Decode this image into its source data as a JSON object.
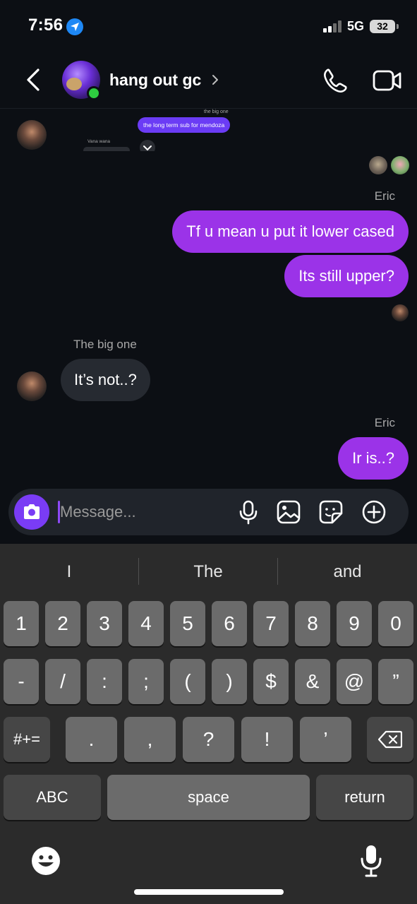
{
  "status_bar": {
    "time": "7:56",
    "network": "5G",
    "battery": "32"
  },
  "header": {
    "title": "hang out gc"
  },
  "reply_preview": {
    "sender": "the big one",
    "text": "the long term sub for mendoza",
    "second_sender": "Vana wana"
  },
  "messages": [
    {
      "sender": "Eric",
      "text": "Tf u mean u put it lower cased",
      "direction": "outgoing"
    },
    {
      "sender": "",
      "text": "Its still upper?",
      "direction": "outgoing"
    },
    {
      "sender": "The big one",
      "text": "It’s not..?",
      "direction": "incoming"
    },
    {
      "sender": "Eric",
      "text": "Ir is..?",
      "direction": "outgoing"
    }
  ],
  "composer": {
    "placeholder": "Message..."
  },
  "keyboard": {
    "suggestions": [
      "I",
      "The",
      "and"
    ],
    "row1": [
      "1",
      "2",
      "3",
      "4",
      "5",
      "6",
      "7",
      "8",
      "9",
      "0"
    ],
    "row2": [
      "-",
      "/",
      ":",
      ";",
      "(",
      ")",
      "$",
      "&",
      "@",
      "”"
    ],
    "row3_switch": "#+=",
    "row3": [
      ".",
      ",",
      "?",
      "!",
      "’"
    ],
    "abc_label": "ABC",
    "space_label": "space",
    "return_label": "return"
  },
  "colors": {
    "outgoing_bubble": "#9b33e8",
    "incoming_bubble": "#262a31",
    "camera_button": "#7a3cf5",
    "online_dot": "#2ecc40",
    "background": "#0c0f14"
  },
  "icons": {
    "status": [
      "location-arrow-icon",
      "cellular-signal-icon",
      "battery-icon"
    ],
    "header": [
      "back-chevron-icon",
      "chevron-right-icon",
      "phone-icon",
      "video-camera-icon"
    ],
    "composer": [
      "camera-icon",
      "microphone-icon",
      "image-icon",
      "sticker-icon",
      "plus-circle-icon"
    ],
    "keyboard": [
      "backspace-icon",
      "emoji-icon",
      "dictation-mic-icon"
    ]
  }
}
